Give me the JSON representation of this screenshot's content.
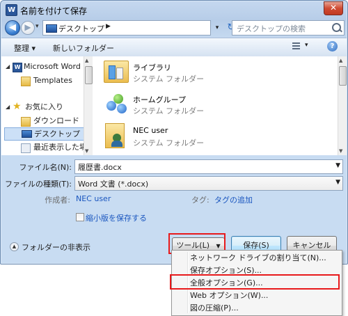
{
  "window": {
    "title": "名前を付けて保存",
    "app_icon_letter": "W",
    "close_symbol": "✕"
  },
  "nav": {
    "address": "デスクトップ",
    "address_arrow": "▶",
    "search_placeholder": "デスクトップの検索"
  },
  "toolbar": {
    "organize": "整理 ▾",
    "new_folder": "新しいフォルダー",
    "help": "?"
  },
  "sidebar": {
    "items": [
      {
        "label": "Microsoft Word",
        "icon": "word-icon"
      },
      {
        "label": "Templates",
        "icon": "folder-icon"
      },
      {
        "label": "お気に入り",
        "icon": "star-icon"
      },
      {
        "label": "ダウンロード",
        "icon": "download-icon"
      },
      {
        "label": "デスクトップ",
        "icon": "desktop-icon",
        "selected": true
      },
      {
        "label": "最近表示した場所",
        "icon": "recent-icon"
      }
    ]
  },
  "files": [
    {
      "name": "ライブラリ",
      "type": "システム フォルダー",
      "icon": "library-icon"
    },
    {
      "name": "ホームグループ",
      "type": "システム フォルダー",
      "icon": "homegroup-icon"
    },
    {
      "name": "NEC user",
      "type": "システム フォルダー",
      "icon": "user-folder-icon"
    }
  ],
  "form": {
    "filename_label": "ファイル名(N):",
    "filename_value": "履歴書.docx",
    "filetype_label": "ファイルの種類(T):",
    "filetype_value": "Word 文書 (*.docx)",
    "author_label": "作成者:",
    "author_value": "NEC user",
    "tag_label": "タグ:",
    "tag_value": "タグの追加",
    "thumbnail_label": "縮小版を保存する"
  },
  "footer": {
    "hide_folders": "フォルダーの非表示",
    "tools": "ツール(L)",
    "tools_arrow": "▼",
    "save": "保存(S)",
    "cancel": "キャンセル"
  },
  "menu": {
    "items": [
      "ネットワーク ドライブの割り当て(N)...",
      "保存オプション(S)...",
      "全般オプション(G)...",
      "Web オプション(W)...",
      "図の圧縮(P)..."
    ]
  },
  "colors": {
    "highlight": "#e8191b",
    "link": "#1a56bf",
    "selection": "#cce0f7"
  }
}
